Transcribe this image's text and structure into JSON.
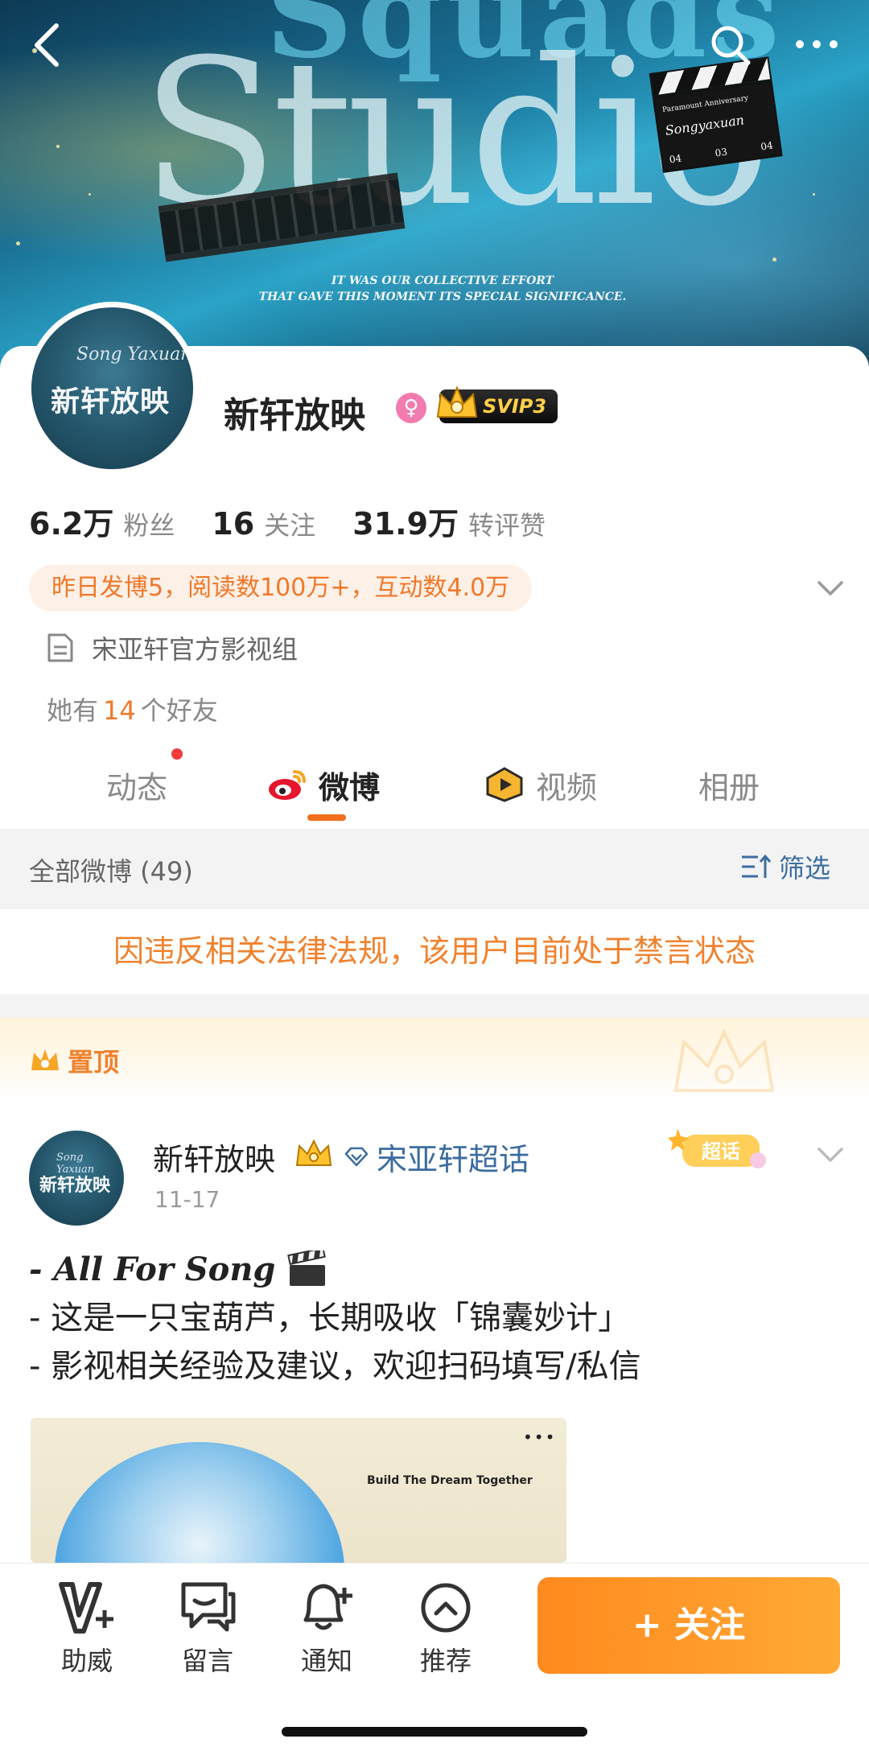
{
  "banner": {
    "top_text": "Squads",
    "studio_text": "Studio",
    "caption_line1": "IT WAS OUR COLLECTIVE EFFORT",
    "caption_line2": "THAT GAVE THIS MOMENT ITS SPECIAL SIGNIFICANCE.",
    "clapper_header": "Paramount Anniversary",
    "clapper_signature": "Songyaxuan",
    "clapper_nums": [
      "04",
      "03",
      "04"
    ]
  },
  "nav": {
    "back_icon": "back-arrow-icon",
    "search_icon": "search-icon",
    "more_icon": "more-icon"
  },
  "profile": {
    "avatar_script": "Song Yaxuan",
    "avatar_title": "新轩放映",
    "username": "新轩放映",
    "gender_symbol": "♀",
    "svip_label": "SVIP3",
    "stats": [
      {
        "num": "6.2万",
        "label": "粉丝"
      },
      {
        "num": "16",
        "label": "关注"
      },
      {
        "num": "31.9万",
        "label": "转评赞"
      }
    ],
    "activity": "昨日发博5，阅读数100万+，互动数4.0万",
    "info": "宋亚轩官方影视组",
    "friends_prefix": "她有",
    "friends_count": "14",
    "friends_suffix": "个好友"
  },
  "tabs": [
    {
      "label": "动态",
      "active": false
    },
    {
      "label": "微博",
      "active": true
    },
    {
      "label": "视频",
      "active": false
    },
    {
      "label": "相册",
      "active": false
    }
  ],
  "filter": {
    "count_label": "全部微博 (49)",
    "filter_label": "筛选"
  },
  "ban_notice": "因违反相关法律法规，该用户目前处于禁言状态",
  "pinned": {
    "label": "置顶"
  },
  "post": {
    "author": "新轩放映",
    "topic": "宋亚轩超话",
    "badge": "超话",
    "date": "11-17",
    "lines": [
      "- All For Song",
      "- 这是一只宝葫芦，长期吸收「锦囊妙计」",
      "- 影视相关经验及建议，欢迎扫码填写/私信"
    ],
    "image_tagline": "Build The Dream Together",
    "image_dots": "•••"
  },
  "bottom_bar": {
    "items": [
      {
        "label": "助威",
        "icon": "v-plus-icon"
      },
      {
        "label": "留言",
        "icon": "chat-bubble-icon"
      },
      {
        "label": "通知",
        "icon": "bell-plus-icon"
      },
      {
        "label": "推荐",
        "icon": "chevron-up-circle-icon"
      }
    ],
    "follow_label": "+ 关注"
  },
  "colors": {
    "accent_orange": "#f0822e",
    "link_blue": "#3c6da0",
    "follow_gradient_start": "#ff8a1e",
    "follow_gradient_end": "#ffa935"
  }
}
